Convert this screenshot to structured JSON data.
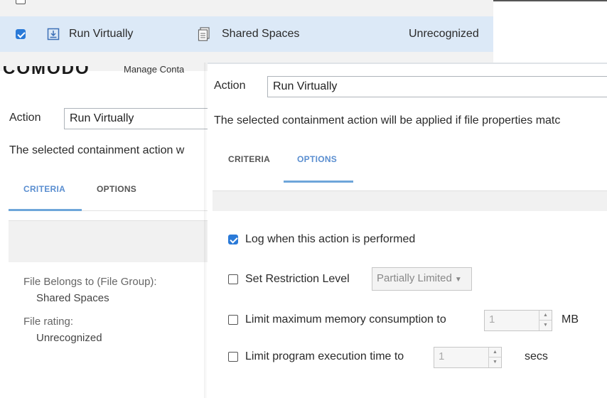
{
  "top_list": {
    "selected_row": {
      "action": "Run Virtually",
      "file_group": "Shared Spaces",
      "rating": "Unrecognized",
      "checked": true
    }
  },
  "back_window": {
    "logo_text": "COMODO",
    "title_fragment": "Manage Conta",
    "action_label": "Action",
    "action_value": "Run Virtually",
    "info_text": "The selected containment action w",
    "tabs": [
      {
        "label": "CRITERIA",
        "active": true
      },
      {
        "label": "OPTIONS",
        "active": false
      }
    ],
    "criteria": [
      {
        "label": "File Belongs to (File Group):",
        "value": "Shared Spaces"
      },
      {
        "label": "File rating:",
        "value": "Unrecognized"
      }
    ]
  },
  "front_window": {
    "action_label": "Action",
    "action_value": "Run Virtually",
    "info_text": "The selected containment action will be applied if file properties matc",
    "tabs": [
      {
        "label": "CRITERIA",
        "active": false
      },
      {
        "label": "OPTIONS",
        "active": true
      }
    ],
    "options": {
      "log": {
        "label": "Log when this action is performed",
        "checked": true
      },
      "restriction": {
        "label": "Set Restriction Level",
        "checked": false,
        "dropdown_value": "Partially Limited"
      },
      "memory": {
        "label": "Limit maximum memory consumption to",
        "checked": false,
        "value": "1",
        "unit": "MB"
      },
      "exec_time": {
        "label": "Limit program execution time to",
        "checked": false,
        "value": "1",
        "unit": "secs"
      }
    }
  },
  "colors": {
    "accent": "#2a7ad8",
    "tab_active": "#5a8ed0",
    "selected_row_bg": "#dce9f7"
  }
}
